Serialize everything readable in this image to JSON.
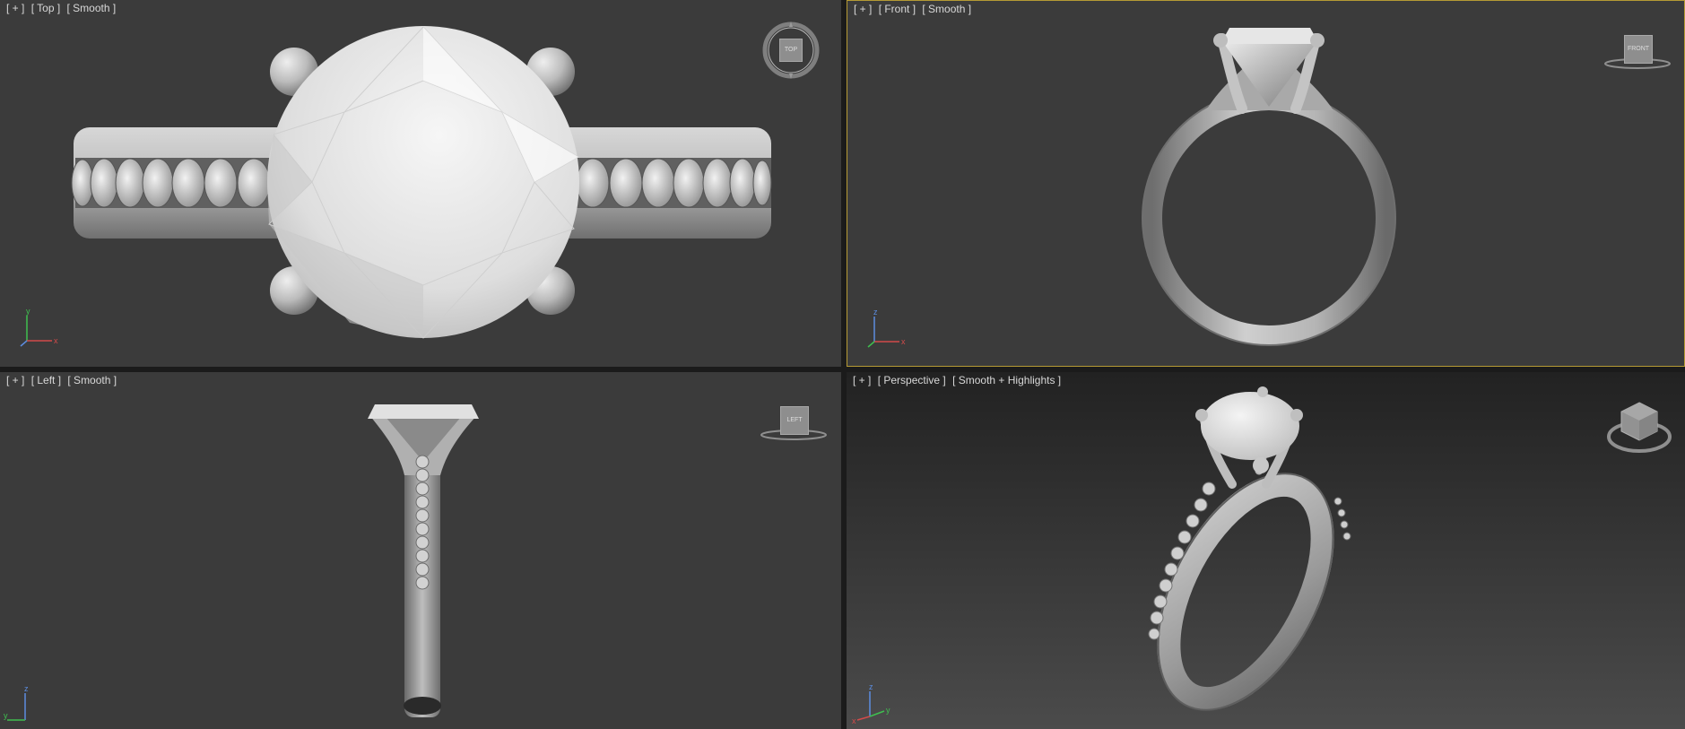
{
  "viewports": {
    "top": {
      "label_parts": [
        "[ + ]",
        "[ Top ]",
        "[ Smooth ]"
      ],
      "viewcube_label": "TOP",
      "axes": [
        "y",
        "x"
      ]
    },
    "front": {
      "label_parts": [
        "[ + ]",
        "[ Front ]",
        "[ Smooth ]"
      ],
      "viewcube_label": "FRONT",
      "axes": [
        "z",
        "x"
      ]
    },
    "left": {
      "label_parts": [
        "[ + ]",
        "[ Left ]",
        "[ Smooth ]"
      ],
      "viewcube_label": "LEFT",
      "axes": [
        "z",
        "y"
      ]
    },
    "perspective": {
      "label_parts": [
        "[ + ]",
        "[ Perspective ]",
        "[ Smooth + Highlights ]"
      ],
      "viewcube_label": "",
      "axes": [
        "z",
        "y",
        "x"
      ]
    }
  },
  "colors": {
    "viewport_background": "#3b3b3b",
    "perspective_gradient_top": "#222222",
    "perspective_gradient_bottom": "#4b4b4b",
    "active_border": "#b59a34",
    "label_text": "#d8d8d8",
    "axis_x": "#d24a4a",
    "axis_y": "#3fbf4f",
    "axis_z": "#5c8de0"
  }
}
